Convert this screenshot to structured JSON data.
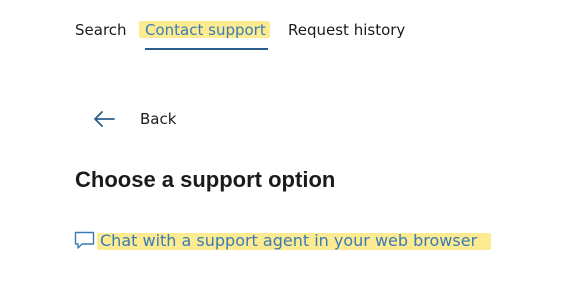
{
  "tabs": [
    {
      "label": "Search",
      "selected": false
    },
    {
      "label": "Contact support",
      "selected": true,
      "highlighted": true
    },
    {
      "label": "Request history",
      "selected": false
    }
  ],
  "back": {
    "label": "Back",
    "icon": "arrow-left-icon"
  },
  "heading": "Choose a support option",
  "options": [
    {
      "label": "Chat with a support agent in your web browser",
      "icon": "chat-bubble-icon",
      "highlighted": true
    }
  ],
  "colors": {
    "text": "#1b1b1b",
    "link": "#3a7bb6",
    "tab_underline": "#2b5e8a",
    "highlight": "#fbe77d"
  }
}
